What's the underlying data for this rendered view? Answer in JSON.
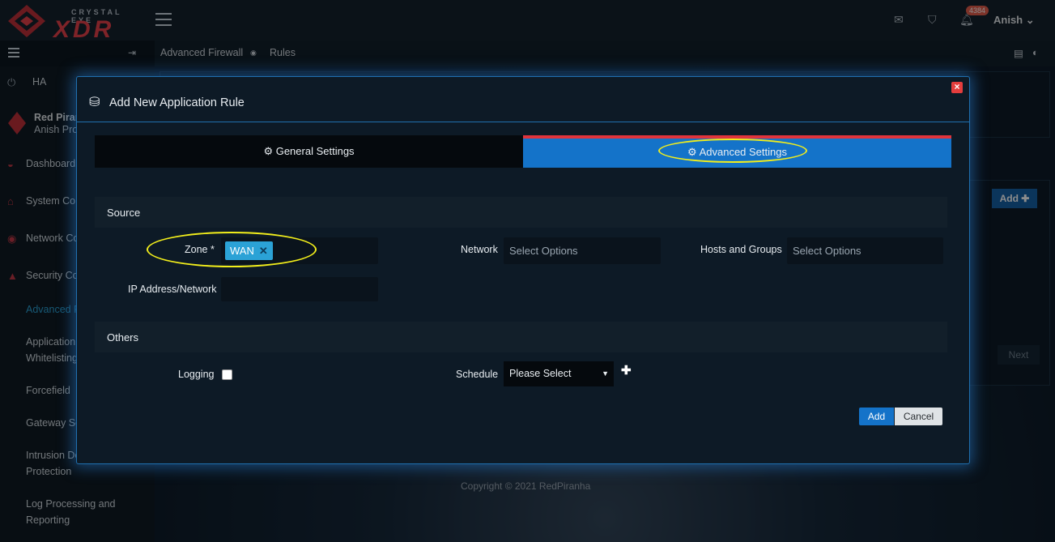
{
  "brand": {
    "logo_top": "CRYSTAL EYE",
    "logo_main": "XDR",
    "accent": "#e6414a"
  },
  "header": {
    "notification_count": "4384",
    "user": "Anish",
    "icons": [
      "hamburger-icon",
      "mail-icon",
      "shield-icon",
      "bell-icon",
      "chevron-down-icon"
    ]
  },
  "sidebar": {
    "ha_label": "HA",
    "profile_name": "Red Piran",
    "profile_sub": "Anish Pro",
    "items": [
      {
        "label": "Dashboard",
        "icon": "dashboard-icon"
      },
      {
        "label": "System Co",
        "icon": "home-icon"
      },
      {
        "label": "Network Co",
        "icon": "globe-icon"
      },
      {
        "label": "Security Co",
        "icon": "up-caret-icon"
      }
    ],
    "subitems": [
      "Advanced F",
      "Application Whitelisting",
      "Forcefield",
      "Gateway Se",
      "Intrusion De Protection",
      "Log Processing and Reporting"
    ]
  },
  "breadcrumb": {
    "parent": "Advanced Firewall",
    "current": "Rules"
  },
  "background": {
    "add_button": "Add",
    "next_button": "Next"
  },
  "modal": {
    "title": "Add New Application Rule",
    "tabs": {
      "general": "General Settings",
      "advanced": "Advanced Settings"
    },
    "source": {
      "section_title": "Source",
      "zone_label": "Zone *",
      "zone_value": "WAN",
      "network_label": "Network",
      "network_placeholder": "Select Options",
      "hosts_label": "Hosts and Groups",
      "hosts_placeholder": "Select Options",
      "ip_label": "IP Address/Network",
      "ip_value": ""
    },
    "others": {
      "section_title": "Others",
      "logging_label": "Logging",
      "logging_checked": false,
      "schedule_label": "Schedule",
      "schedule_value": "Please Select"
    },
    "buttons": {
      "add": "Add",
      "cancel": "Cancel"
    }
  },
  "footer": {
    "copyright": "Copyright © 2021 RedPiranha"
  },
  "colors": {
    "primary_blue": "#1473c9",
    "annotation_yellow": "#f2ee1b",
    "tab_active_border": "#e0343c",
    "chip_blue": "#2ba2d6"
  }
}
